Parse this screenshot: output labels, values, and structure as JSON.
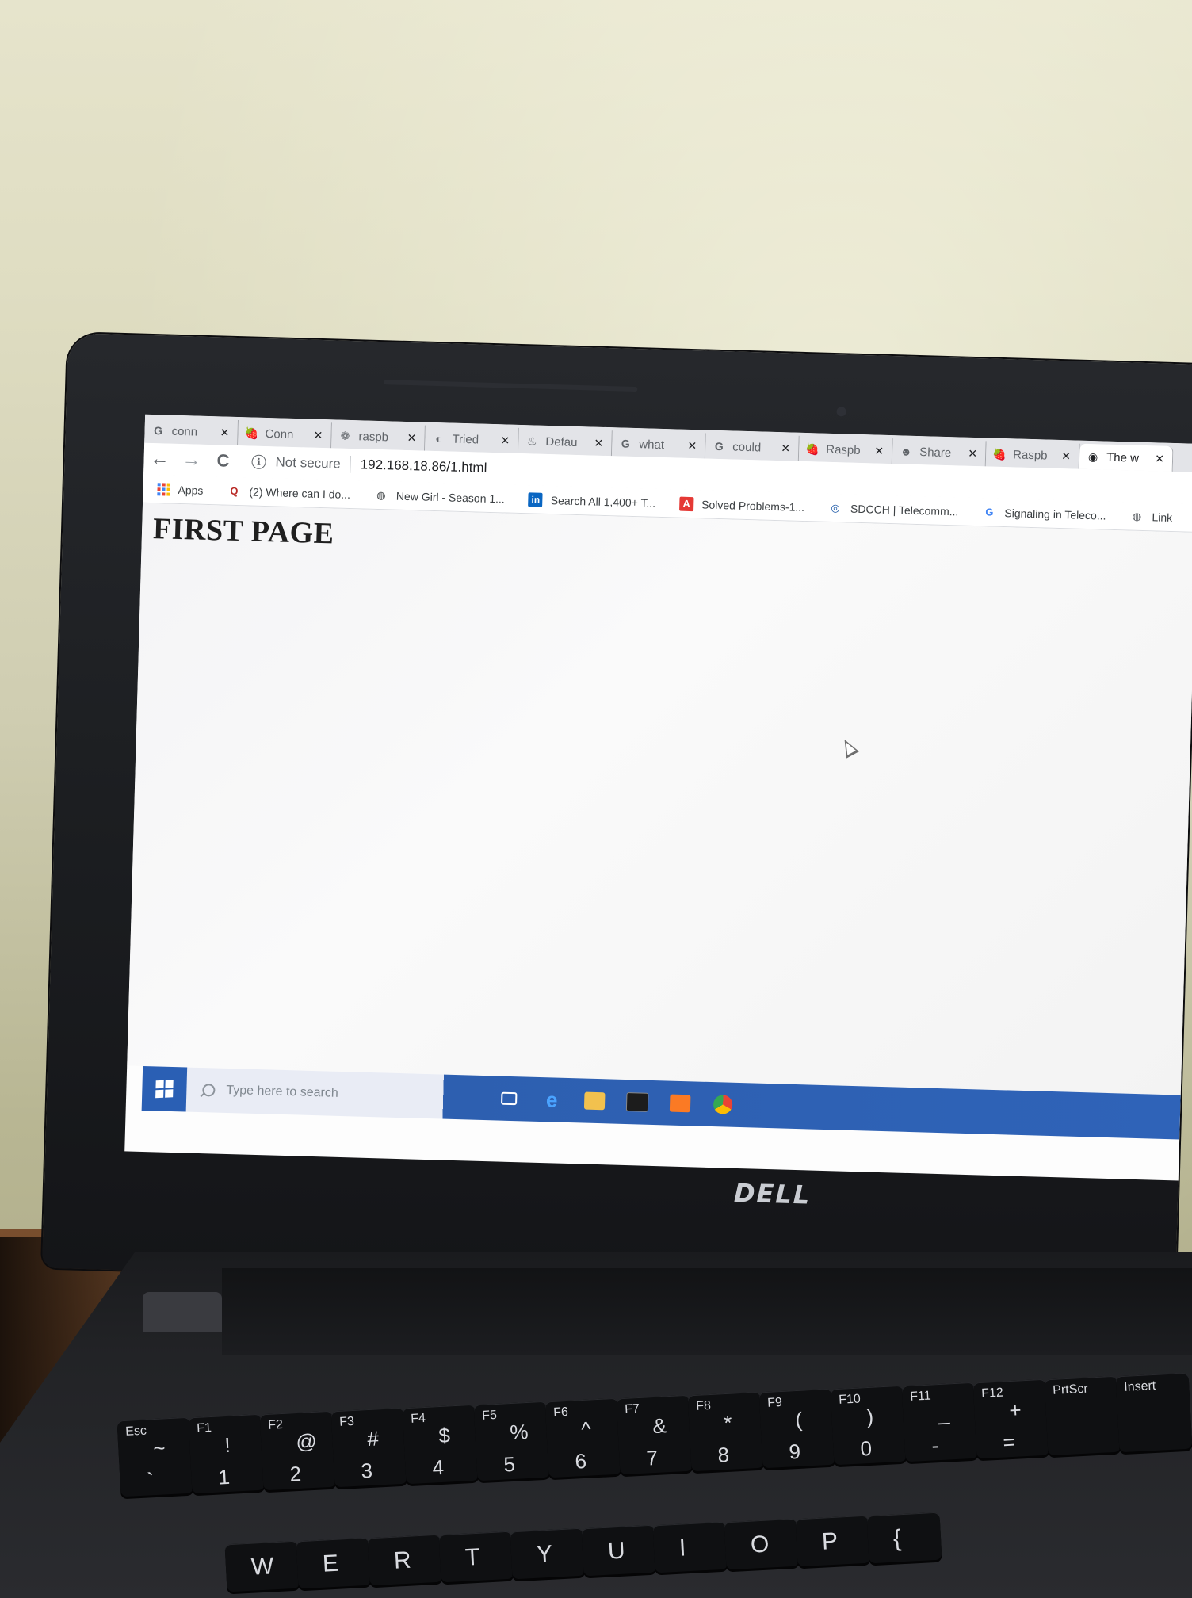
{
  "browser": {
    "tabs": [
      {
        "title": "conn",
        "favicon": "G",
        "favicon_color": "#4285f4",
        "close": "✕"
      },
      {
        "title": "Conn",
        "favicon": "🍓",
        "favicon_color": "#c51a4a",
        "close": "✕"
      },
      {
        "title": "raspb",
        "favicon": "❁",
        "favicon_color": "#d9477a",
        "close": "✕"
      },
      {
        "title": "Tried",
        "favicon": "◐",
        "favicon_color": "#1a7f37",
        "close": "✕"
      },
      {
        "title": "Defau",
        "favicon": "♨",
        "favicon_color": "#f48024",
        "close": "✕"
      },
      {
        "title": "what",
        "favicon": "G",
        "favicon_color": "#4285f4",
        "close": "✕"
      },
      {
        "title": "could",
        "favicon": "G",
        "favicon_color": "#4285f4",
        "close": "✕"
      },
      {
        "title": "Raspb",
        "favicon": "🍓",
        "favicon_color": "#c51a4a",
        "close": "✕"
      },
      {
        "title": "Share",
        "favicon": "☻",
        "favicon_color": "#e8a33d",
        "close": "✕"
      },
      {
        "title": "Raspb",
        "favicon": "🍓",
        "favicon_color": "#c51a4a",
        "close": "✕"
      },
      {
        "title": "The w",
        "favicon": "◉",
        "favicon_color": "#24292e",
        "close": "✕"
      }
    ],
    "nav": {
      "back": "←",
      "forward": "→",
      "reload": "C"
    },
    "omnibox": {
      "security_label": "Not secure",
      "url": "192.168.18.86/1.html"
    },
    "bookmarks": [
      {
        "label": "Apps",
        "icon": "apps-grid"
      },
      {
        "label": "(2) Where can I do...",
        "icon": "Q",
        "icon_color": "#b92b27"
      },
      {
        "label": "New Girl - Season 1...",
        "icon": "◍",
        "icon_color": "#3c4043"
      },
      {
        "label": "Search All 1,400+ T...",
        "icon": "in",
        "icon_color": "#0a66c2"
      },
      {
        "label": "Solved Problems-1...",
        "icon": "A",
        "icon_color": "#e53935"
      },
      {
        "label": "SDCCH | Telecomm...",
        "icon": "◎",
        "icon_color": "#1e5aa8"
      },
      {
        "label": "Signaling in Teleco...",
        "icon": "G",
        "icon_color": "#4285f4"
      },
      {
        "label": "Link",
        "icon": "◍",
        "icon_color": "#5f6368"
      }
    ]
  },
  "page": {
    "heading": "FIRST PAGE"
  },
  "taskbar": {
    "search_placeholder": "Type here to search"
  },
  "laptop": {
    "brand": "DELL"
  },
  "keyboard": {
    "keys": [
      {
        "top": "Esc",
        "sym": "~",
        "num": "`"
      },
      {
        "top": "F1",
        "sym": "!",
        "num": "1"
      },
      {
        "top": "F2",
        "sym": "@",
        "num": "2"
      },
      {
        "top": "F3",
        "sym": "#",
        "num": "3"
      },
      {
        "top": "F4",
        "sym": "$",
        "num": "4"
      },
      {
        "top": "F5",
        "sym": "%",
        "num": "5"
      },
      {
        "top": "F6",
        "sym": "^",
        "num": "6"
      },
      {
        "top": "F7",
        "sym": "&",
        "num": "7"
      },
      {
        "top": "F8",
        "sym": "*",
        "num": "8"
      },
      {
        "top": "F9",
        "sym": "(",
        "num": "9"
      },
      {
        "top": "F10",
        "sym": ")",
        "num": "0"
      },
      {
        "top": "F11",
        "sym": "_",
        "num": "-"
      },
      {
        "top": "F12",
        "sym": "+",
        "num": "="
      },
      {
        "top": "PrtScr",
        "sym": "",
        "num": ""
      },
      {
        "top": "Insert",
        "sym": "",
        "num": ""
      }
    ],
    "letters": [
      "W",
      "E",
      "R",
      "T",
      "Y",
      "U",
      "I",
      "O",
      "P",
      "{"
    ]
  }
}
